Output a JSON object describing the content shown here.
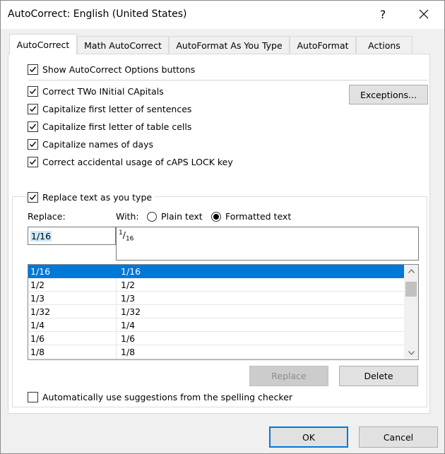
{
  "window": {
    "title": "AutoCorrect: English (United States)",
    "help_glyph": "?",
    "close_icon": "close-icon"
  },
  "tabs": [
    {
      "label": "AutoCorrect",
      "active": true
    },
    {
      "label": "Math AutoCorrect",
      "active": false
    },
    {
      "label": "AutoFormat As You Type",
      "active": false
    },
    {
      "label": "AutoFormat",
      "active": false
    },
    {
      "label": "Actions",
      "active": false
    }
  ],
  "options": {
    "show_buttons": {
      "label": "Show AutoCorrect Options buttons",
      "checked": true
    },
    "correct_two_initial": {
      "label": "Correct TWo INitial CApitals",
      "checked": true
    },
    "capitalize_sentences": {
      "label": "Capitalize first letter of sentences",
      "checked": true
    },
    "capitalize_table_cells": {
      "label": "Capitalize first letter of table cells",
      "checked": true
    },
    "capitalize_days": {
      "label": "Capitalize names of days",
      "checked": true
    },
    "correct_caps_lock": {
      "label": "Correct accidental usage of cAPS LOCK key",
      "checked": true
    },
    "exceptions_button": "Exceptions..."
  },
  "replace_section": {
    "replace_as_you_type": {
      "label": "Replace text as you type",
      "checked": true
    },
    "replace_label": "Replace:",
    "with_label": "With:",
    "plain_text": {
      "label": "Plain text",
      "selected": false
    },
    "formatted_text": {
      "label": "Formatted text",
      "selected": true
    },
    "replace_value": "1/16",
    "with_value": {
      "numerator": "1",
      "slash": "/",
      "denominator": "16"
    }
  },
  "entries": [
    {
      "replace": "1/16",
      "with": "1/16",
      "selected": true
    },
    {
      "replace": "1/2",
      "with": "1/2",
      "selected": false
    },
    {
      "replace": "1/3",
      "with": "1/3",
      "selected": false
    },
    {
      "replace": "1/32",
      "with": "1/32",
      "selected": false
    },
    {
      "replace": "1/4",
      "with": "1/4",
      "selected": false
    },
    {
      "replace": "1/6",
      "with": "1/6",
      "selected": false
    },
    {
      "replace": "1/8",
      "with": "1/8",
      "selected": false
    }
  ],
  "actions": {
    "replace_button": "Replace",
    "delete_button": "Delete"
  },
  "spelling": {
    "label": "Automatically use suggestions from the spelling checker",
    "checked": false
  },
  "footer": {
    "ok_button": "OK",
    "cancel_button": "Cancel"
  },
  "colors": {
    "accent": "#0078d7",
    "selection_highlight": "#cce8ff"
  }
}
